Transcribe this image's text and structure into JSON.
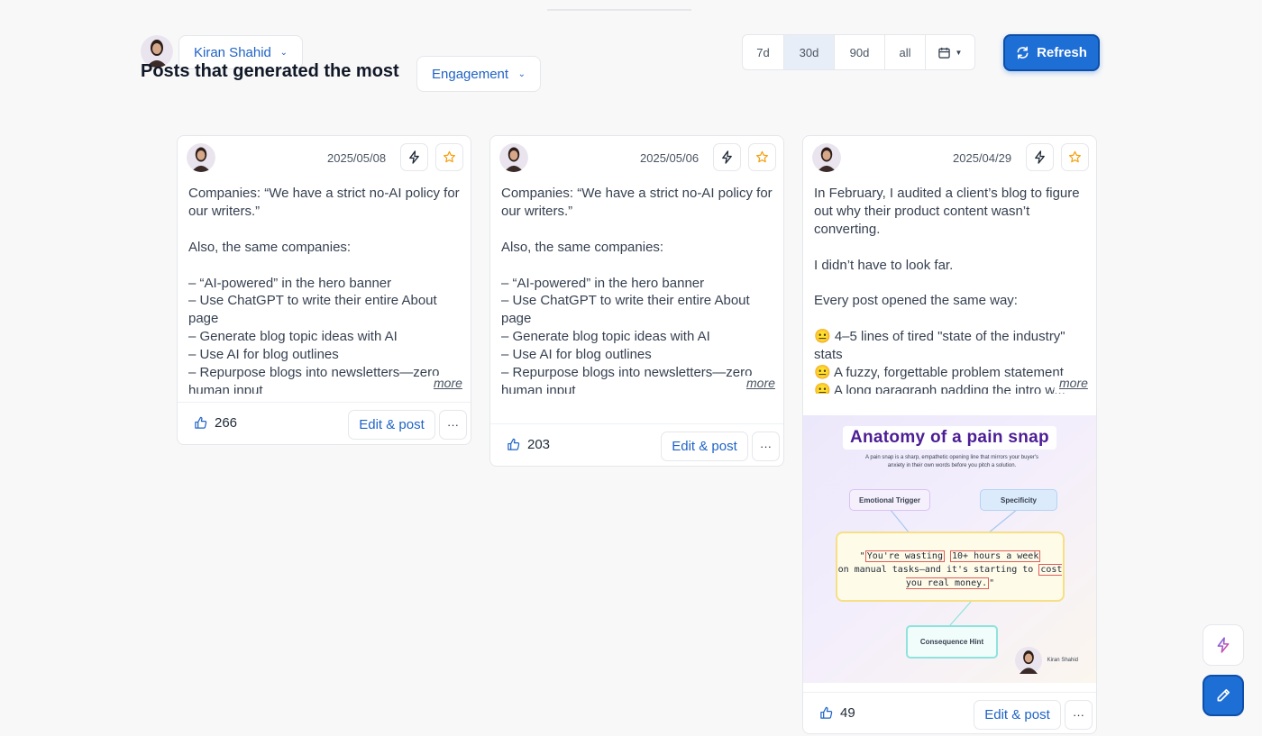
{
  "header": {
    "profile_name": "Kiran Shahid",
    "title": "Posts that generated the most",
    "metric_selected": "Engagement",
    "ranges": [
      "7d",
      "30d",
      "90d",
      "all"
    ],
    "active_range": "30d",
    "refresh_label": "Refresh"
  },
  "posts": [
    {
      "date": "2025/05/08",
      "text": "Companies: “We have a strict no-AI policy for our writers.”\n\nAlso, the same companies:\n\n– “AI-powered” in the hero banner\n– Use ChatGPT to write their entire About page\n– Generate blog topic ideas with AI\n– Use AI for blog outlines\n– Repurpose blogs into newsletters—zero human input",
      "more_label": "more",
      "likes": "266",
      "edit_label": "Edit & post",
      "menu_label": "···"
    },
    {
      "date": "2025/05/06",
      "text": "Companies: “We have a strict no-AI policy for our writers.”\n\nAlso, the same companies:\n\n– “AI-powered” in the hero banner\n– Use ChatGPT to write their entire About page\n– Generate blog topic ideas with AI\n– Use AI for blog outlines\n– Repurpose blogs into newsletters—zero human input",
      "more_label": "more",
      "likes": "203",
      "edit_label": "Edit & post",
      "menu_label": "···"
    },
    {
      "date": "2025/04/29",
      "text": "In February, I audited a client’s blog to figure out why their product content wasn’t converting.\n\nI didn’t have to look far.\n\nEvery post opened the same way:\n\n😐 4–5 lines of tired \"state of the industry\" stats\n😐 A fuzzy, forgettable problem statement\n😐 A long paragraph padding the intro w...",
      "more_label": "more",
      "likes": "49",
      "edit_label": "Edit & post",
      "menu_label": "···",
      "image": {
        "title": "Anatomy of a pain snap",
        "subtitle": "A pain snap is a sharp, empathetic opening line that mirrors your buyer's anxiety in their own words before you pitch a solution.",
        "tag_emotional": "Emotional Trigger",
        "tag_specificity": "Specificity",
        "tag_consequence": "Consequence Hint",
        "quote_open": "\"",
        "quote_part1": "You're wasting",
        "quote_part2": "10+ hours a week",
        "quote_part3": "on manual tasks—and it's starting to",
        "quote_part4": "cost you real money.",
        "quote_close": "\"",
        "author": "Kiran Shahid"
      }
    }
  ],
  "colors": {
    "accent": "#1d6fd6",
    "link": "#1f63c6",
    "star": "#f59e0b",
    "purple": "#4c1d95"
  },
  "icons": {
    "bolt": "lightning-bolt-icon",
    "star": "star-icon",
    "like": "thumbs-up-icon",
    "refresh": "refresh-icon",
    "calendar": "calendar-icon",
    "pencil": "pencil-icon"
  }
}
